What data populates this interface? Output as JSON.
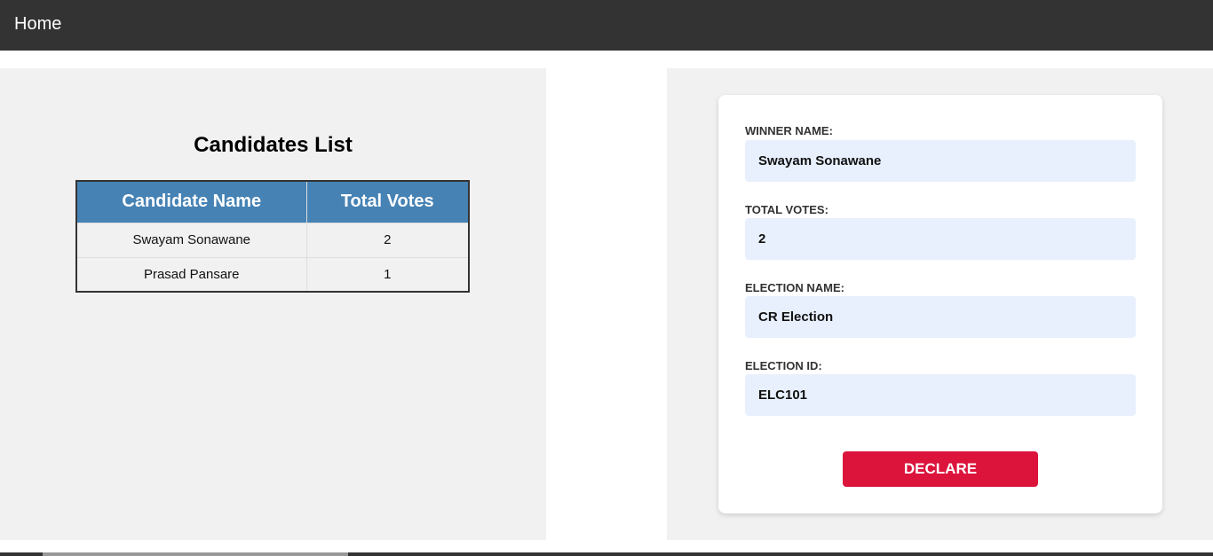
{
  "nav": {
    "home_label": "Home"
  },
  "candidates": {
    "title": "Candidates List",
    "columns": [
      "Candidate Name",
      "Total Votes"
    ],
    "rows": [
      {
        "name": "Swayam Sonawane",
        "votes": "2"
      },
      {
        "name": "Prasad Pansare",
        "votes": "1"
      }
    ]
  },
  "form": {
    "winner_name_label": "WINNER NAME:",
    "winner_name_value": "Swayam Sonawane",
    "total_votes_label": "TOTAL VOTES:",
    "total_votes_value": "2",
    "election_name_label": "ELECTION NAME:",
    "election_name_value": "CR Election",
    "election_id_label": "ELECTION ID:",
    "election_id_value": "ELC101",
    "declare_label": "DECLARE"
  },
  "colors": {
    "navbar": "#333333",
    "table_header": "#4682b4",
    "declare_button": "#dc143c",
    "input_background": "#e8f0fe",
    "panel_background": "#f1f1f1"
  }
}
